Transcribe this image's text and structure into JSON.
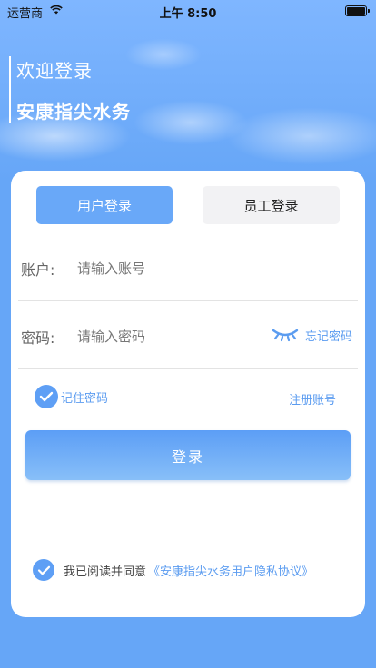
{
  "status_bar": {
    "carrier": "运营商",
    "time": "上午 8:50"
  },
  "header": {
    "welcome": "欢迎登录",
    "app_name": "安康指尖水务"
  },
  "tabs": {
    "user_login": "用户登录",
    "staff_login": "员工登录"
  },
  "account": {
    "label": "账户:",
    "placeholder": "请输入账号"
  },
  "password": {
    "label": "密码:",
    "placeholder": "请输入密码",
    "forgot": "忘记密码"
  },
  "options": {
    "remember": "记住密码",
    "register": "注册账号"
  },
  "login_button": "登录",
  "agreement": {
    "text": "我已阅读并同意",
    "link": "《安康指尖水务用户隐私协议》"
  },
  "colors": {
    "accent": "#5b9cf0",
    "background": "#66a6f7",
    "tab_active": "#69a8f8"
  }
}
